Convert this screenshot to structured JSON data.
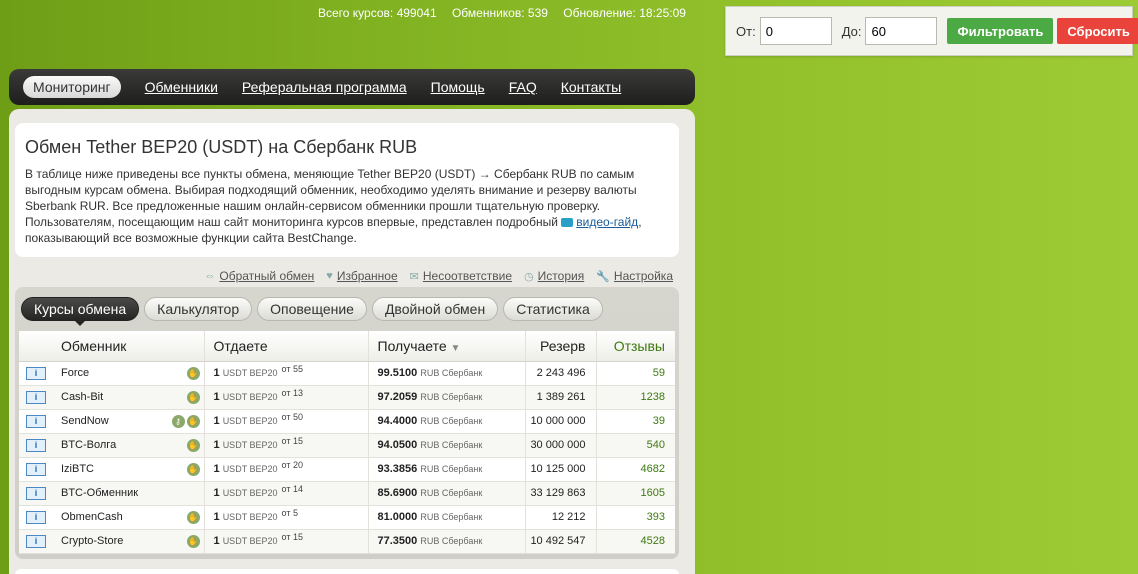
{
  "stats": {
    "total_rates": "Всего курсов: 499041",
    "exchangers": "Обменников: 539",
    "updated": "Обновление: 18:25:09"
  },
  "filter": {
    "from_label": "От:",
    "from_value": "0",
    "to_label": "До:",
    "to_value": "60",
    "filter_button": "Фильтровать",
    "reset_button": "Сбросить"
  },
  "nav": {
    "items": [
      "Мониторинг",
      "Обменники",
      "Реферальная программа",
      "Помощь",
      "FAQ",
      "Контакты"
    ]
  },
  "intro": {
    "title": "Обмен Tether BEP20 (USDT) на Сбербанк RUB",
    "text": "В таблице ниже приведены все пункты обмена, меняющие Tether BEP20 (USDT) → Сбербанк RUB по самым выгодным курсам обмена. Выбирая подходящий обменник, необходимо уделять внимание и резерву валюты Sberbank RUR. Все предложенные нашим онлайн-сервисом обменники прошли тщательную проверку. Пользователям, посещающим наш сайт мониторинга курсов впервые, представлен подробный",
    "video_link": "видео-гайд",
    "text_end": ", показывающий все возможные функции сайта BestChange."
  },
  "utils": [
    "Обратный обмен",
    "Избранное",
    "Несоответствие",
    "История",
    "Настройка"
  ],
  "tabs": [
    "Курсы обмена",
    "Калькулятор",
    "Оповещение",
    "Двойной обмен",
    "Статистика"
  ],
  "table": {
    "headers": {
      "exchanger": "Обменник",
      "give": "Отдаете",
      "get": "Получаете",
      "reserve": "Резерв",
      "reviews": "Отзывы"
    },
    "give_currency": "USDT BEP20",
    "get_currency": "RUB Сбербанк",
    "rows": [
      {
        "name": "Force",
        "give": "1",
        "from": "от 55",
        "get": "99.5100",
        "reserve": "2 243 496",
        "reviews": "59"
      },
      {
        "name": "Cash-Bit",
        "give": "1",
        "from": "от 13",
        "get": "97.2059",
        "reserve": "1 389 261",
        "reviews": "1238"
      },
      {
        "name": "SendNow",
        "give": "1",
        "from": "от 50",
        "get": "94.4000",
        "reserve": "10 000 000",
        "reviews": "39"
      },
      {
        "name": "BTC-Волга",
        "give": "1",
        "from": "от 15",
        "get": "94.0500",
        "reserve": "30 000 000",
        "reviews": "540"
      },
      {
        "name": "IziBTC",
        "give": "1",
        "from": "от 20",
        "get": "93.3856",
        "reserve": "10 125 000",
        "reviews": "4682"
      },
      {
        "name": "BTC-Обменник",
        "give": "1",
        "from": "от 14",
        "get": "85.6900",
        "reserve": "33 129 863",
        "reviews": "1605"
      },
      {
        "name": "ObmenCash",
        "give": "1",
        "from": "от 5",
        "get": "81.0000",
        "reserve": "12 212",
        "reviews": "393"
      },
      {
        "name": "Crypto-Store",
        "give": "1",
        "from": "от 15",
        "get": "77.3500",
        "reserve": "10 492 547",
        "reviews": "4528"
      }
    ]
  }
}
